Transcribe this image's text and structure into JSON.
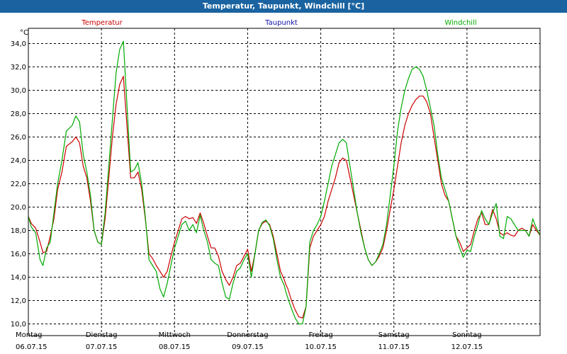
{
  "window": {
    "title": "Temperatur, Taupunkt, Windchill [°C]"
  },
  "colors": {
    "temperatur": "#cc0000",
    "taupunkt": "#1010aa",
    "windchill": "#00aa00",
    "grid": "#000000",
    "axis": "#000000"
  },
  "chart_data": {
    "type": "line",
    "title": "Temperatur, Taupunkt, Windchill [°C]",
    "ylabel": "°C",
    "ylim": [
      9.0,
      35.3
    ],
    "yticks": [
      "10,0",
      "12,0",
      "14,0",
      "16,0",
      "18,0",
      "20,0",
      "22,0",
      "24,0",
      "26,0",
      "28,0",
      "30,0",
      "32,0",
      "34,0"
    ],
    "grid": true,
    "legend": "top",
    "xlim": [
      0,
      7
    ],
    "x_labels": [
      {
        "day": "Montag",
        "date": "06.07.15"
      },
      {
        "day": "Dienstag",
        "date": "07.07.15"
      },
      {
        "day": "Mittwoch",
        "date": "08.07.15"
      },
      {
        "day": "Donnerstag",
        "date": "09.07.15"
      },
      {
        "day": "Freitag",
        "date": "10.07.15"
      },
      {
        "day": "Samstag",
        "date": "11.07.15"
      },
      {
        "day": "Sonntag",
        "date": "12.07.15"
      }
    ],
    "series": [
      {
        "name": "Temperatur",
        "color": "#cc0000",
        "x": [
          0.0,
          0.04,
          0.1,
          0.16,
          0.2,
          0.25,
          0.3,
          0.35,
          0.4,
          0.46,
          0.52,
          0.6,
          0.65,
          0.7,
          0.75,
          0.8,
          0.85,
          0.9,
          0.95,
          1.0,
          1.05,
          1.1,
          1.15,
          1.2,
          1.25,
          1.3,
          1.4,
          1.45,
          1.5,
          1.55,
          1.6,
          1.65,
          1.7,
          1.75,
          1.8,
          1.85,
          1.9,
          1.95,
          2.0,
          2.05,
          2.1,
          2.15,
          2.2,
          2.25,
          2.3,
          2.35,
          2.4,
          2.45,
          2.5,
          2.55,
          2.6,
          2.65,
          2.7,
          2.75,
          2.8,
          2.85,
          2.9,
          2.95,
          3.0,
          3.05,
          3.1,
          3.15,
          3.2,
          3.25,
          3.3,
          3.35,
          3.4,
          3.45,
          3.5,
          3.52,
          3.55,
          3.6,
          3.65,
          3.7,
          3.75,
          3.8,
          3.85,
          3.9,
          3.95,
          4.0,
          4.05,
          4.1,
          4.15,
          4.2,
          4.25,
          4.3,
          4.35,
          4.4,
          4.45,
          4.5,
          4.55,
          4.6,
          4.65,
          4.7,
          4.75,
          4.8,
          4.85,
          4.9,
          4.95,
          5.0,
          5.05,
          5.1,
          5.15,
          5.2,
          5.25,
          5.3,
          5.35,
          5.4,
          5.45,
          5.5,
          5.55,
          5.6,
          5.65,
          5.7,
          5.75,
          5.8,
          5.85,
          5.9,
          5.95,
          6.0,
          6.05,
          6.1,
          6.15,
          6.2,
          6.25,
          6.3,
          6.35,
          6.4,
          6.45,
          6.5,
          6.55,
          6.6,
          6.65,
          6.7,
          6.75,
          6.8,
          6.85,
          6.9,
          6.95,
          7.0
        ],
        "values": [
          19.2,
          18.6,
          18.2,
          17.0,
          16.1,
          16.2,
          17.5,
          19.0,
          21.5,
          23.0,
          25.2,
          25.6,
          26.0,
          25.5,
          23.5,
          22.5,
          20.5,
          18.0,
          17.0,
          16.8,
          19.0,
          22.5,
          26.0,
          28.8,
          30.5,
          31.2,
          22.5,
          22.5,
          23.0,
          21.5,
          19.0,
          16.0,
          15.6,
          15.0,
          14.5,
          14.0,
          14.5,
          15.8,
          17.0,
          18.0,
          19.0,
          19.2,
          19.0,
          19.1,
          18.6,
          19.5,
          18.6,
          17.5,
          16.5,
          16.5,
          15.8,
          14.5,
          13.8,
          13.3,
          14.0,
          15.0,
          15.2,
          15.8,
          16.4,
          14.5,
          16.0,
          18.0,
          18.6,
          18.8,
          18.5,
          17.5,
          16.0,
          14.5,
          13.8,
          13.4,
          13.0,
          12.0,
          11.2,
          10.6,
          10.5,
          11.5,
          16.5,
          17.5,
          18.0,
          18.5,
          19.2,
          20.5,
          21.5,
          22.5,
          23.8,
          24.2,
          24.0,
          22.5,
          21.0,
          19.5,
          18.0,
          16.5,
          15.5,
          15.0,
          15.3,
          15.8,
          16.5,
          18.0,
          19.8,
          21.5,
          23.5,
          25.5,
          27.0,
          28.0,
          28.7,
          29.2,
          29.5,
          29.5,
          29.0,
          28.0,
          26.0,
          24.0,
          22.0,
          21.0,
          20.5,
          19.0,
          17.5,
          17.0,
          16.2,
          16.5,
          16.8,
          18.0,
          19.0,
          19.5,
          18.5,
          18.5,
          19.8,
          19.0,
          17.8,
          17.6,
          17.8,
          17.6,
          17.5,
          18.0,
          18.2,
          18.0,
          17.5,
          18.5,
          18.0,
          17.6
        ],
        "note": "values read approximately"
      },
      {
        "name": "Taupunkt",
        "color": "#1010aa",
        "x": [],
        "values": []
      },
      {
        "name": "Windchill",
        "color": "#00aa00",
        "x": [
          0.0,
          0.04,
          0.1,
          0.16,
          0.2,
          0.25,
          0.3,
          0.35,
          0.4,
          0.46,
          0.52,
          0.6,
          0.65,
          0.7,
          0.75,
          0.8,
          0.85,
          0.9,
          0.95,
          1.0,
          1.05,
          1.1,
          1.15,
          1.2,
          1.25,
          1.3,
          1.4,
          1.45,
          1.5,
          1.55,
          1.6,
          1.65,
          1.7,
          1.75,
          1.8,
          1.85,
          1.9,
          1.95,
          2.0,
          2.05,
          2.1,
          2.15,
          2.2,
          2.25,
          2.3,
          2.35,
          2.4,
          2.45,
          2.5,
          2.55,
          2.6,
          2.65,
          2.7,
          2.75,
          2.8,
          2.85,
          2.9,
          2.95,
          3.0,
          3.05,
          3.1,
          3.15,
          3.2,
          3.25,
          3.3,
          3.35,
          3.4,
          3.45,
          3.5,
          3.52,
          3.55,
          3.6,
          3.65,
          3.7,
          3.75,
          3.8,
          3.85,
          3.9,
          3.95,
          4.0,
          4.05,
          4.1,
          4.15,
          4.2,
          4.25,
          4.3,
          4.35,
          4.4,
          4.45,
          4.5,
          4.55,
          4.6,
          4.65,
          4.7,
          4.75,
          4.8,
          4.85,
          4.9,
          4.95,
          5.0,
          5.05,
          5.1,
          5.15,
          5.2,
          5.25,
          5.3,
          5.35,
          5.4,
          5.45,
          5.5,
          5.55,
          5.6,
          5.65,
          5.7,
          5.75,
          5.8,
          5.85,
          5.9,
          5.95,
          6.0,
          6.05,
          6.1,
          6.15,
          6.2,
          6.25,
          6.3,
          6.35,
          6.4,
          6.45,
          6.5,
          6.55,
          6.6,
          6.65,
          6.7,
          6.75,
          6.8,
          6.85,
          6.9,
          6.95,
          7.0
        ],
        "values": [
          19.2,
          18.3,
          17.8,
          15.5,
          15.0,
          16.5,
          17.0,
          19.5,
          22.0,
          24.0,
          26.5,
          27.0,
          27.8,
          27.3,
          24.5,
          23.0,
          21.0,
          18.0,
          17.0,
          16.8,
          19.5,
          23.5,
          27.5,
          31.5,
          33.5,
          34.2,
          23.0,
          23.2,
          23.8,
          22.0,
          19.2,
          15.5,
          15.0,
          14.5,
          13.0,
          12.3,
          13.5,
          15.0,
          16.5,
          17.5,
          18.5,
          18.8,
          18.0,
          18.5,
          17.8,
          19.3,
          18.0,
          17.0,
          15.5,
          15.2,
          15.0,
          13.5,
          12.3,
          12.1,
          13.5,
          14.5,
          14.8,
          15.5,
          16.0,
          14.0,
          16.0,
          18.0,
          18.7,
          18.9,
          18.4,
          17.3,
          15.5,
          14.0,
          13.3,
          12.8,
          12.2,
          11.3,
          10.5,
          10.0,
          10.0,
          11.5,
          17.0,
          18.0,
          18.5,
          19.2,
          20.5,
          22.0,
          23.5,
          24.5,
          25.5,
          25.8,
          25.5,
          23.5,
          21.5,
          19.5,
          17.8,
          16.5,
          15.5,
          15.0,
          15.3,
          16.0,
          16.8,
          18.5,
          21.0,
          23.5,
          26.5,
          28.5,
          30.0,
          31.0,
          31.8,
          32.0,
          31.8,
          31.2,
          30.0,
          28.5,
          27.0,
          24.5,
          22.5,
          21.5,
          20.5,
          19.0,
          17.5,
          16.5,
          15.7,
          16.3,
          16.2,
          17.5,
          18.5,
          19.7,
          19.0,
          18.5,
          19.5,
          20.3,
          17.5,
          17.3,
          19.2,
          19.0,
          18.5,
          18.0,
          18.0,
          18.0,
          17.5,
          19.0,
          18.2,
          17.6
        ],
        "note": "values read approximately"
      }
    ]
  }
}
